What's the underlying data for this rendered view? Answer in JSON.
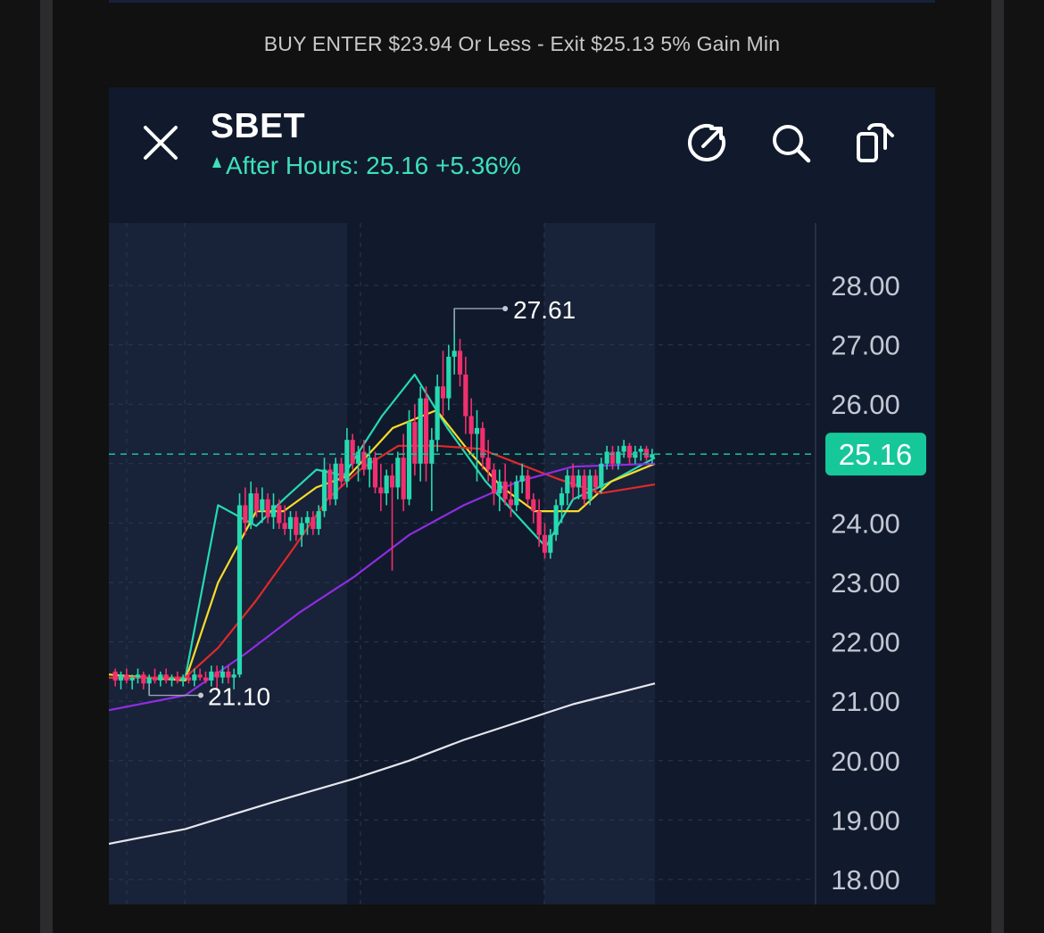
{
  "caption": "BUY ENTER $23.94 Or Less - Exit $25.13 5% Gain Min",
  "header": {
    "ticker": "SBET",
    "after_hours_label": "After Hours: 25.16 +5.36%",
    "accent_color": "#3ee0b9",
    "icons": [
      "close-icon",
      "share-icon",
      "search-icon",
      "copy-icon"
    ]
  },
  "chart_data": {
    "type": "candlestick",
    "y_axis_ticks": [
      "28.00",
      "27.00",
      "26.00",
      "25.00",
      "24.00",
      "23.00",
      "22.00",
      "21.00",
      "20.00",
      "19.00",
      "18.00"
    ],
    "ylim": [
      17.5,
      29.0
    ],
    "current_price": 25.16,
    "current_price_label": "25.16",
    "high": 27.61,
    "high_label": "27.61",
    "low": 21.1,
    "low_label": "21.10",
    "colors": {
      "up": "#26d9b0",
      "down": "#f0306e",
      "current": "#16c79a"
    },
    "candles": [
      [
        21.5,
        21.55,
        21.25,
        21.35
      ],
      [
        21.35,
        21.5,
        21.2,
        21.45
      ],
      [
        21.45,
        21.55,
        21.3,
        21.35
      ],
      [
        21.35,
        21.45,
        21.2,
        21.4
      ],
      [
        21.4,
        21.55,
        21.3,
        21.45
      ],
      [
        21.45,
        21.5,
        21.2,
        21.3
      ],
      [
        21.3,
        21.45,
        21.1,
        21.4
      ],
      [
        21.4,
        21.55,
        21.3,
        21.35
      ],
      [
        21.35,
        21.5,
        21.25,
        21.45
      ],
      [
        21.45,
        21.55,
        21.3,
        21.35
      ],
      [
        21.35,
        21.45,
        21.25,
        21.4
      ],
      [
        21.4,
        21.5,
        21.3,
        21.35
      ],
      [
        21.35,
        21.45,
        21.25,
        21.4
      ],
      [
        21.4,
        21.5,
        21.3,
        21.35
      ],
      [
        21.35,
        21.55,
        21.25,
        21.45
      ],
      [
        21.45,
        21.55,
        21.35,
        21.4
      ],
      [
        21.4,
        21.5,
        21.3,
        21.35
      ],
      [
        21.35,
        21.6,
        21.25,
        21.5
      ],
      [
        21.5,
        21.6,
        21.2,
        21.4
      ],
      [
        21.4,
        21.6,
        21.3,
        21.5
      ],
      [
        21.5,
        21.6,
        21.3,
        21.4
      ],
      [
        21.4,
        21.55,
        21.2,
        21.45
      ],
      [
        21.45,
        24.5,
        21.4,
        24.3
      ],
      [
        24.3,
        24.6,
        23.8,
        24.0
      ],
      [
        24.0,
        24.7,
        23.9,
        24.5
      ],
      [
        24.5,
        24.6,
        24.1,
        24.2
      ],
      [
        24.2,
        24.6,
        24.0,
        24.4
      ],
      [
        24.4,
        24.5,
        24.0,
        24.1
      ],
      [
        24.1,
        24.5,
        23.9,
        24.3
      ],
      [
        24.3,
        24.4,
        23.9,
        24.0
      ],
      [
        24.0,
        24.3,
        23.8,
        23.9
      ],
      [
        23.9,
        24.2,
        23.7,
        24.1
      ],
      [
        24.1,
        24.2,
        23.7,
        23.8
      ],
      [
        23.8,
        24.1,
        23.6,
        24.0
      ],
      [
        24.0,
        24.2,
        23.8,
        24.1
      ],
      [
        24.1,
        24.2,
        23.8,
        23.9
      ],
      [
        23.9,
        24.3,
        23.8,
        24.2
      ],
      [
        24.2,
        25.1,
        24.1,
        24.9
      ],
      [
        24.9,
        25.0,
        24.3,
        24.4
      ],
      [
        24.4,
        25.1,
        24.3,
        25.0
      ],
      [
        25.0,
        25.1,
        24.6,
        24.7
      ],
      [
        24.7,
        25.6,
        24.6,
        25.4
      ],
      [
        25.4,
        25.5,
        24.9,
        25.0
      ],
      [
        25.0,
        25.3,
        24.7,
        25.2
      ],
      [
        25.2,
        25.4,
        24.8,
        24.9
      ],
      [
        24.9,
        25.3,
        24.6,
        25.1
      ],
      [
        25.1,
        25.2,
        24.5,
        24.6
      ],
      [
        24.6,
        25.0,
        24.2,
        24.5
      ],
      [
        24.5,
        24.9,
        24.3,
        24.8
      ],
      [
        24.8,
        25.0,
        23.2,
        24.6
      ],
      [
        24.6,
        25.2,
        24.4,
        25.1
      ],
      [
        25.1,
        25.5,
        24.2,
        24.4
      ],
      [
        24.4,
        25.9,
        24.3,
        25.7
      ],
      [
        25.7,
        26.0,
        24.8,
        25.0
      ],
      [
        25.0,
        26.3,
        24.7,
        26.1
      ],
      [
        26.1,
        26.3,
        24.7,
        25.0
      ],
      [
        25.0,
        25.6,
        24.2,
        25.4
      ],
      [
        25.4,
        26.5,
        25.2,
        26.3
      ],
      [
        26.3,
        26.9,
        25.8,
        26.1
      ],
      [
        26.1,
        27.0,
        25.9,
        26.8
      ],
      [
        26.8,
        27.61,
        26.5,
        26.9
      ],
      [
        26.9,
        27.1,
        26.3,
        26.5
      ],
      [
        26.5,
        26.8,
        25.5,
        25.8
      ],
      [
        25.8,
        26.1,
        25.2,
        25.5
      ],
      [
        25.5,
        25.9,
        24.7,
        25.6
      ],
      [
        25.6,
        25.7,
        24.9,
        25.1
      ],
      [
        25.1,
        25.4,
        24.7,
        24.9
      ],
      [
        24.9,
        25.0,
        24.3,
        24.5
      ],
      [
        24.5,
        24.9,
        24.2,
        24.7
      ],
      [
        24.7,
        25.0,
        24.3,
        24.4
      ],
      [
        24.4,
        24.7,
        24.1,
        24.3
      ],
      [
        24.3,
        24.8,
        24.2,
        24.7
      ],
      [
        24.7,
        25.0,
        24.5,
        24.8
      ],
      [
        24.8,
        24.9,
        24.3,
        24.4
      ],
      [
        24.4,
        24.5,
        24.0,
        24.2
      ],
      [
        24.2,
        24.4,
        23.6,
        23.8
      ],
      [
        23.8,
        24.0,
        23.4,
        23.5
      ],
      [
        23.5,
        23.9,
        23.4,
        23.8
      ],
      [
        23.8,
        24.4,
        23.7,
        24.3
      ],
      [
        24.3,
        24.6,
        24.0,
        24.5
      ],
      [
        24.5,
        24.9,
        24.3,
        24.8
      ],
      [
        24.8,
        25.0,
        24.4,
        24.6
      ],
      [
        24.6,
        24.9,
        24.4,
        24.8
      ],
      [
        24.8,
        24.9,
        24.3,
        24.4
      ],
      [
        24.4,
        24.9,
        24.3,
        24.8
      ],
      [
        24.8,
        24.9,
        24.5,
        24.6
      ],
      [
        24.6,
        25.1,
        24.5,
        25.0
      ],
      [
        25.0,
        25.3,
        24.9,
        25.2
      ],
      [
        25.2,
        25.3,
        24.9,
        25.0
      ],
      [
        25.0,
        25.3,
        24.9,
        25.2
      ],
      [
        25.2,
        25.4,
        25.1,
        25.3
      ],
      [
        25.3,
        25.35,
        25.0,
        25.1
      ],
      [
        25.1,
        25.3,
        25.0,
        25.2
      ],
      [
        25.2,
        25.3,
        25.05,
        25.25
      ],
      [
        25.25,
        25.3,
        25.05,
        25.1
      ],
      [
        25.1,
        25.25,
        25.0,
        25.16
      ]
    ],
    "moving_averages": [
      {
        "color": "#26d9b0",
        "points": [
          [
            0,
            21.4
          ],
          [
            0.14,
            21.4
          ],
          [
            0.2,
            24.3
          ],
          [
            0.27,
            23.95
          ],
          [
            0.32,
            24.4
          ],
          [
            0.38,
            24.9
          ],
          [
            0.43,
            24.8
          ],
          [
            0.5,
            25.8
          ],
          [
            0.56,
            26.5
          ],
          [
            0.62,
            25.6
          ],
          [
            0.69,
            24.7
          ],
          [
            0.76,
            24.0
          ],
          [
            0.8,
            23.6
          ],
          [
            0.85,
            24.4
          ],
          [
            0.92,
            24.7
          ],
          [
            1.0,
            25.1
          ]
        ]
      },
      {
        "color": "#f7dc2a",
        "points": [
          [
            0,
            21.45
          ],
          [
            0.14,
            21.35
          ],
          [
            0.2,
            23.0
          ],
          [
            0.27,
            24.2
          ],
          [
            0.32,
            24.2
          ],
          [
            0.38,
            24.6
          ],
          [
            0.44,
            24.8
          ],
          [
            0.52,
            25.6
          ],
          [
            0.6,
            25.9
          ],
          [
            0.66,
            25.2
          ],
          [
            0.72,
            24.6
          ],
          [
            0.78,
            24.2
          ],
          [
            0.86,
            24.2
          ],
          [
            0.92,
            24.7
          ],
          [
            1.0,
            25.0
          ]
        ]
      },
      {
        "color": "#e02a2a",
        "points": [
          [
            0,
            21.4
          ],
          [
            0.14,
            21.4
          ],
          [
            0.2,
            21.9
          ],
          [
            0.27,
            22.7
          ],
          [
            0.34,
            23.6
          ],
          [
            0.4,
            24.4
          ],
          [
            0.46,
            24.9
          ],
          [
            0.53,
            25.3
          ],
          [
            0.6,
            25.3
          ],
          [
            0.68,
            25.25
          ],
          [
            0.75,
            25.0
          ],
          [
            0.82,
            24.75
          ],
          [
            0.9,
            24.5
          ],
          [
            1.0,
            24.65
          ]
        ]
      },
      {
        "color": "#8e2de2",
        "points": [
          [
            0,
            20.85
          ],
          [
            0.14,
            21.1
          ],
          [
            0.25,
            21.8
          ],
          [
            0.35,
            22.5
          ],
          [
            0.45,
            23.1
          ],
          [
            0.55,
            23.8
          ],
          [
            0.65,
            24.3
          ],
          [
            0.75,
            24.7
          ],
          [
            0.85,
            24.95
          ],
          [
            1.0,
            25.0
          ]
        ]
      },
      {
        "color": "#e6e6ee",
        "points": [
          [
            0,
            18.6
          ],
          [
            0.14,
            18.85
          ],
          [
            0.3,
            19.3
          ],
          [
            0.45,
            19.7
          ],
          [
            0.55,
            20.0
          ],
          [
            0.65,
            20.35
          ],
          [
            0.75,
            20.65
          ],
          [
            0.85,
            20.95
          ],
          [
            1.0,
            21.3
          ]
        ]
      }
    ]
  }
}
